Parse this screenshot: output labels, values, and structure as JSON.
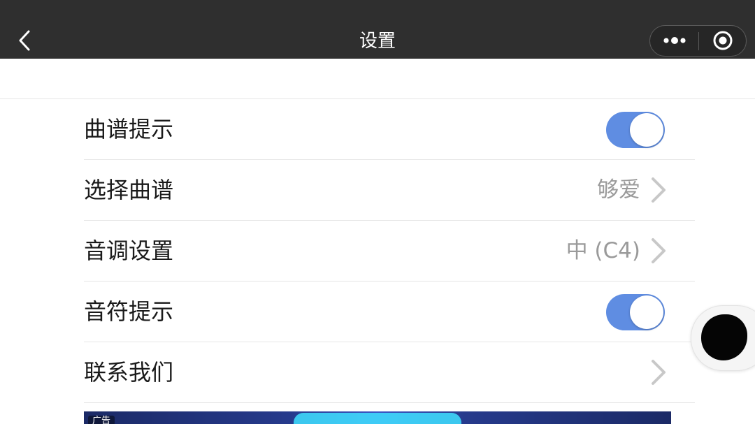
{
  "header": {
    "title": "设置",
    "back_icon": "chevron-left-icon",
    "more_icon": "more-dots-icon",
    "close_icon": "target-close-icon"
  },
  "settings": {
    "items": [
      {
        "label": "曲谱提示",
        "type": "toggle",
        "on": true
      },
      {
        "label": "选择曲谱",
        "type": "link",
        "value": "够爱"
      },
      {
        "label": "音调设置",
        "type": "link",
        "value": "中 (C4)"
      },
      {
        "label": "音符提示",
        "type": "toggle",
        "on": true
      },
      {
        "label": "联系我们",
        "type": "link",
        "value": ""
      }
    ]
  },
  "ad": {
    "tag": "广告"
  },
  "colors": {
    "topbar": "#2f2f2f",
    "toggle_on": "#5f8de2",
    "value_text": "#9a9a9a"
  }
}
